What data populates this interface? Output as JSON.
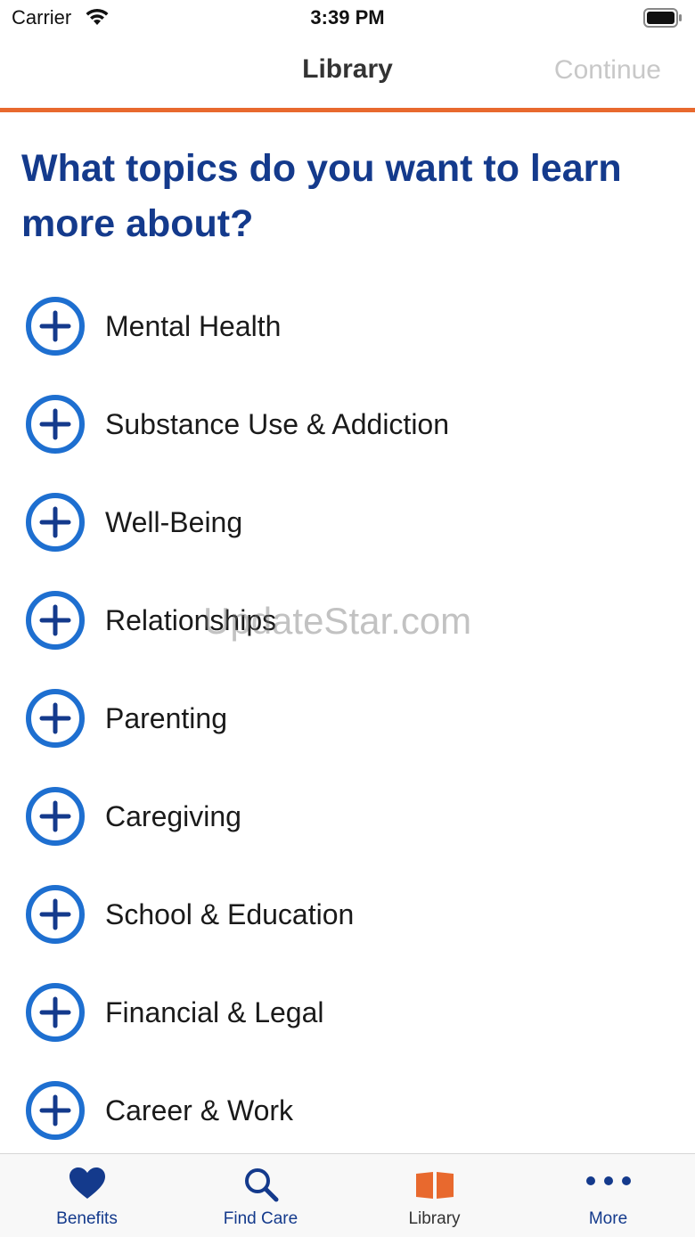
{
  "status_bar": {
    "carrier": "Carrier",
    "time": "3:39 PM"
  },
  "nav": {
    "title": "Library",
    "continue_label": "Continue"
  },
  "heading": "What topics do you want to learn more about?",
  "topics": [
    {
      "label": "Mental Health"
    },
    {
      "label": "Substance Use & Addiction"
    },
    {
      "label": "Well-Being"
    },
    {
      "label": "Relationships"
    },
    {
      "label": "Parenting"
    },
    {
      "label": "Caregiving"
    },
    {
      "label": "School & Education"
    },
    {
      "label": "Financial & Legal"
    },
    {
      "label": "Career & Work"
    }
  ],
  "watermark": "UpdateStar.com",
  "tabs": [
    {
      "label": "Benefits",
      "icon": "heart-icon"
    },
    {
      "label": "Find Care",
      "icon": "search-icon"
    },
    {
      "label": "Library",
      "icon": "book-icon",
      "active": true
    },
    {
      "label": "More",
      "icon": "more-dots-icon"
    }
  ],
  "colors": {
    "primary": "#143a8c",
    "accent_blue": "#1e6fd0",
    "accent_orange": "#e8692e",
    "disabled": "#c8c8c8"
  }
}
